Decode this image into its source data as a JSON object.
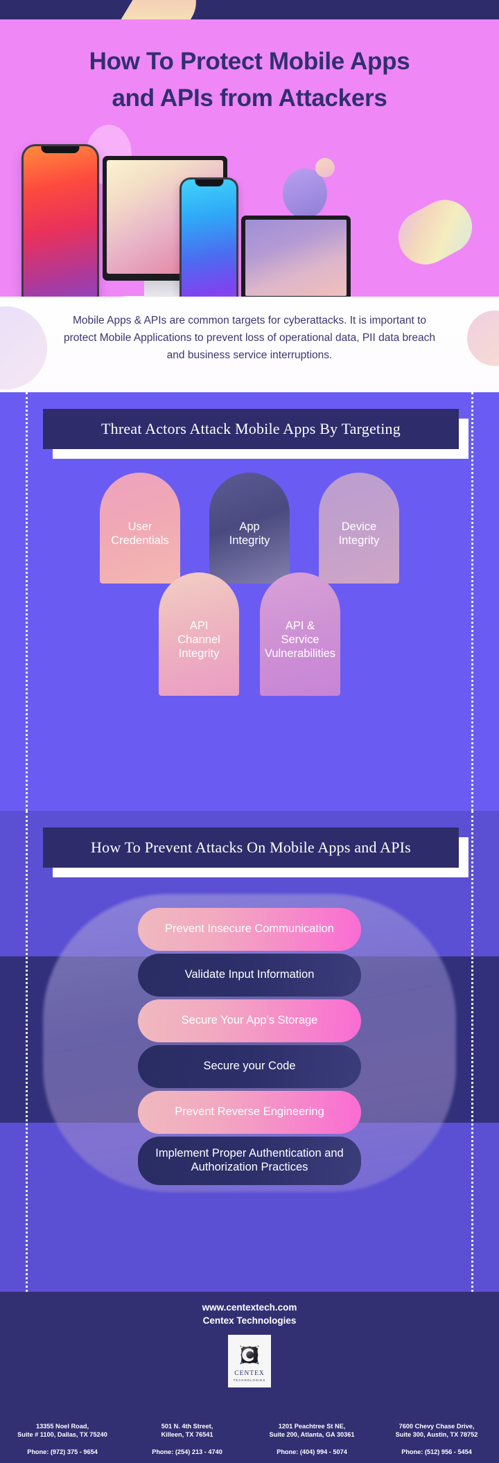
{
  "hero": {
    "title_line1": "How To Protect Mobile Apps",
    "title_line2": "and APIs from Attackers",
    "bg_color": "#ef87f7",
    "title_color": "#312f6e",
    "devices": [
      "phone-large",
      "desktop-monitor",
      "phone-small",
      "laptop"
    ]
  },
  "intro": {
    "paragraph": "Mobile Apps & APIs are common targets for cyberattacks. It is important to protect Mobile Applications to prevent loss of operational data, PII data breach and business service interruptions."
  },
  "threats": {
    "banner": "Threat Actors Attack Mobile Apps By Targeting",
    "bg_color": "#6a5cf2",
    "banner_color": "#2e2c6b",
    "items": [
      {
        "label": "User\nCredentials"
      },
      {
        "label": "App\nIntegrity"
      },
      {
        "label": "Device\nIntegrity"
      },
      {
        "label": "API\nChannel\nIntegrity"
      },
      {
        "label": "API &\nService\nVulnerabilities"
      }
    ]
  },
  "prevent": {
    "banner": "How To Prevent Attacks On Mobile Apps and APIs",
    "bg_color": "#5b4fd4",
    "items": [
      {
        "label": "Prevent Insecure Communication",
        "style": "pink"
      },
      {
        "label": "Validate Input Information",
        "style": "dark"
      },
      {
        "label": "Secure Your App's Storage",
        "style": "pink"
      },
      {
        "label": "Secure your Code",
        "style": "dark"
      },
      {
        "label": "Prevent Reverse Engineering",
        "style": "pink"
      },
      {
        "label": "Implement Proper Authentication and Authorization Practices",
        "style": "dark"
      }
    ]
  },
  "footer": {
    "website": "www.centextech.com",
    "company": "Centex Technologies",
    "logo_name": "CENTEX",
    "logo_sub": "TECHNOLOGIES",
    "bg_color": "#332f73",
    "addresses": [
      {
        "line1": "13355 Noel Road,",
        "line2": "Suite # 1100, Dallas, TX 75240",
        "phone": "Phone: (972) 375 - 9654"
      },
      {
        "line1": "501 N. 4th Street,",
        "line2": "Killeen, TX 76541",
        "phone": "Phone: (254) 213 - 4740"
      },
      {
        "line1": "1201 Peachtree St NE,",
        "line2": "Suite 200, Atlanta, GA 30361",
        "phone": "Phone: (404) 994 - 5074"
      },
      {
        "line1": "7600 Chevy Chase Drive,",
        "line2": "Suite 300, Austin, TX 78752",
        "phone": "Phone: (512) 956 - 5454"
      }
    ]
  }
}
